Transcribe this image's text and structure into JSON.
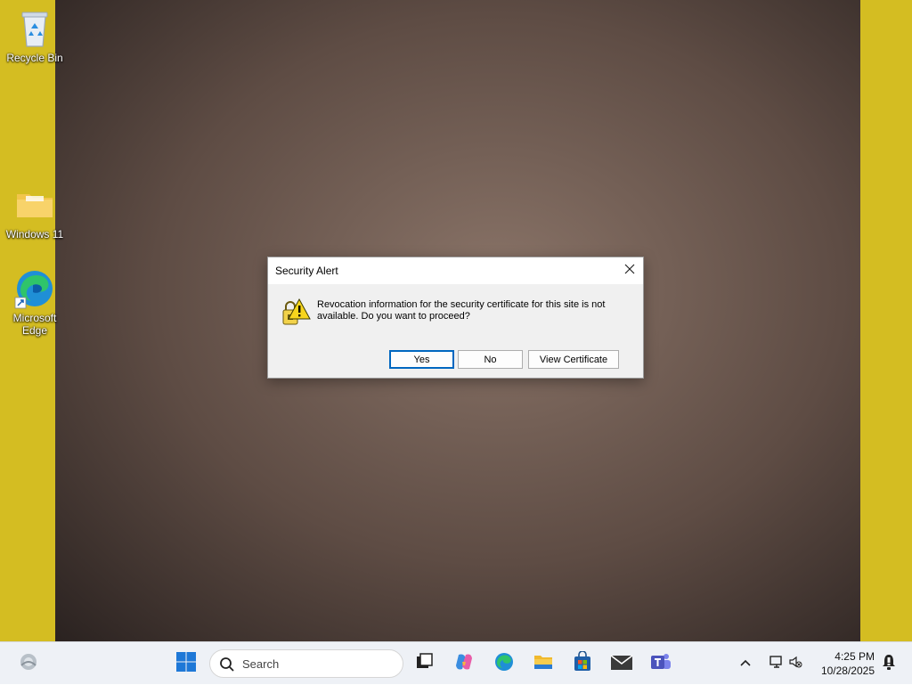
{
  "desktop": {
    "background_color": "#d4bd22",
    "icons": [
      {
        "label": "Recycle Bin",
        "icon": "recycle-bin-icon"
      },
      {
        "label": "Windows 11",
        "icon": "folder-icon"
      },
      {
        "label": "Microsoft Edge",
        "icon": "edge-icon"
      }
    ]
  },
  "dialog": {
    "title": "Security Alert",
    "message": "Revocation information for the security certificate for this site is not available. Do you want to proceed?",
    "buttons": {
      "yes": "Yes",
      "no": "No",
      "view_certificate": "View Certificate"
    },
    "icons": {
      "warning": "warning-lock-icon",
      "close": "close-icon"
    }
  },
  "taskbar": {
    "search_placeholder": "Search",
    "apps": [
      "weather-icon",
      "start-icon",
      "task-view-icon",
      "copilot-icon",
      "edge-icon",
      "file-explorer-icon",
      "microsoft-store-icon",
      "mail-icon",
      "teams-icon"
    ],
    "tray": {
      "time": "4:25 PM",
      "date": "10/28/2025"
    },
    "accent_color": "#0067c0"
  }
}
